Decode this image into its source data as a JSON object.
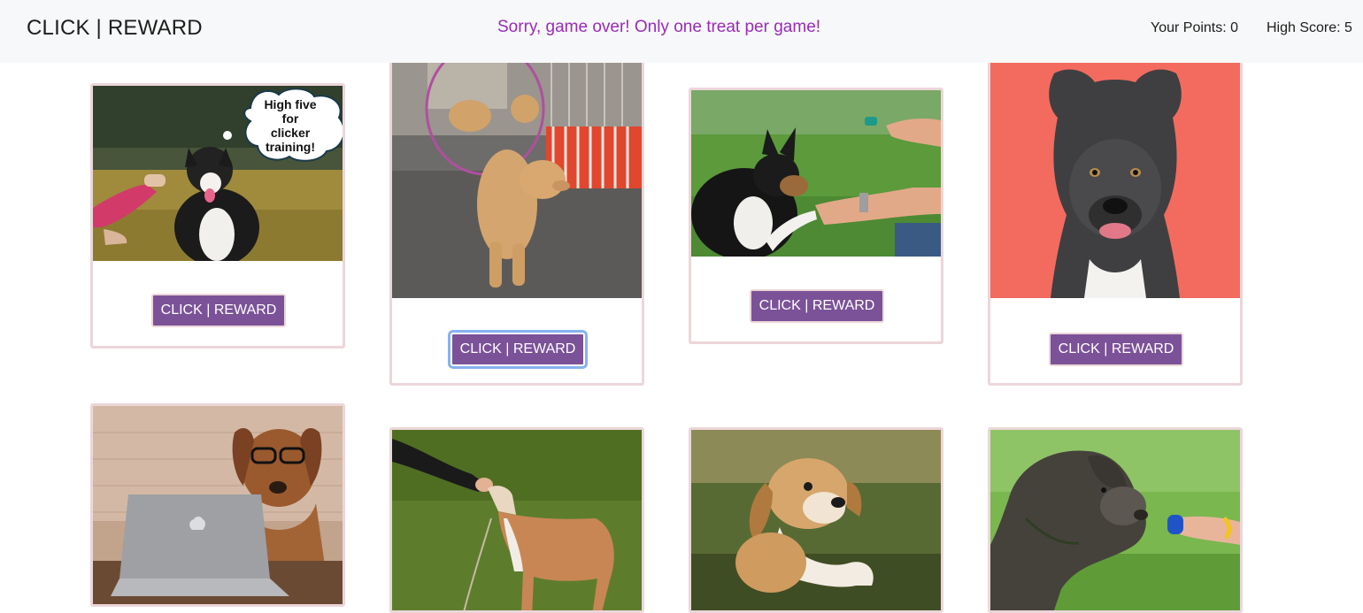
{
  "navbar": {
    "brand": "CLICK | REWARD",
    "message": "Sorry, game over! Only one treat per game!",
    "points": "Your Points: 0",
    "high_score": "High Score: 5"
  },
  "cards": [
    {
      "button_label": "CLICK | REWARD",
      "image": "australian-shepherd-high-five",
      "bubble_text": [
        "High five",
        "for",
        "clicker",
        "training!"
      ]
    },
    {
      "button_label": "CLICK | REWARD",
      "image": "poodle-jumping-hoop"
    },
    {
      "button_label": "CLICK | REWARD",
      "image": "puppy-paw-shake-clicker"
    },
    {
      "button_label": "CLICK | REWARD",
      "image": "grey-pitbull-red-background"
    },
    {
      "button_label": "",
      "image": "dog-with-glasses-laptop"
    },
    {
      "button_label": "",
      "image": "whippet-treat"
    },
    {
      "button_label": "",
      "image": "jumping-beagle-mix"
    },
    {
      "button_label": "",
      "image": "wirehaired-pointer-clicker"
    }
  ],
  "colors": {
    "message": "#9a2bb8",
    "button": "#7b5298",
    "card_border": "#ecd6d9",
    "focus_ring": "#86b2f0"
  }
}
